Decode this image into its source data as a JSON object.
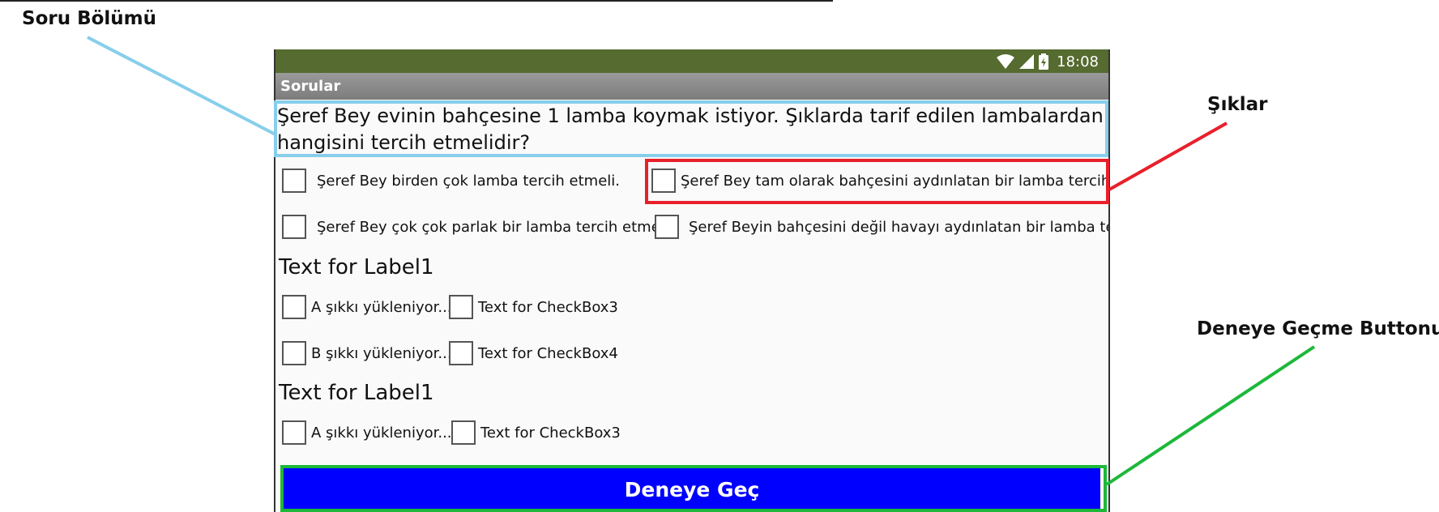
{
  "annotations": {
    "question_section": "Soru Bölümü",
    "options": "Şıklar",
    "go_button_label": "Deneye Geçme Buttonu",
    "colors": {
      "question": "#87ceeb",
      "options": "#e8202a",
      "go_button": "#1db83a"
    }
  },
  "status_bar": {
    "time": "18:08",
    "icons": [
      "wifi-icon",
      "signal-icon",
      "battery-icon"
    ],
    "color": "#556b2f"
  },
  "title_bar": {
    "title": "Sorular"
  },
  "question": {
    "line1": " Şeref Bey evinin bahçesine 1 lamba koymak istiyor. Şıklarda tarif edilen lambalardan",
    "line2": "hangisini tercih etmelidir?"
  },
  "options": [
    {
      "label": "Şeref Bey birden çok lamba tercih etmeli.",
      "checked": false
    },
    {
      "label": "Şeref Bey tam olarak bahçesini aydınlatan bir lamba tercih etr",
      "checked": false
    },
    {
      "label": "Şeref Bey çok çok parlak bir lamba tercih etmeli.",
      "checked": false
    },
    {
      "label": "Şeref Beyin bahçesini değil havayı aydınlatan bir lamba tercih",
      "checked": false
    }
  ],
  "sections": [
    {
      "label": "Text for Label1",
      "rows": [
        [
          "A şıkkı yükleniyor...",
          "Text for CheckBox3"
        ],
        [
          "B şıkkı yükleniyor...",
          "Text for CheckBox4"
        ]
      ]
    },
    {
      "label": "Text for Label1",
      "rows": [
        [
          "A şıkkı yükleniyor...",
          "Text for CheckBox3"
        ]
      ]
    }
  ],
  "go_button": {
    "label": "Deneye Geç",
    "color": "#0000ff"
  }
}
